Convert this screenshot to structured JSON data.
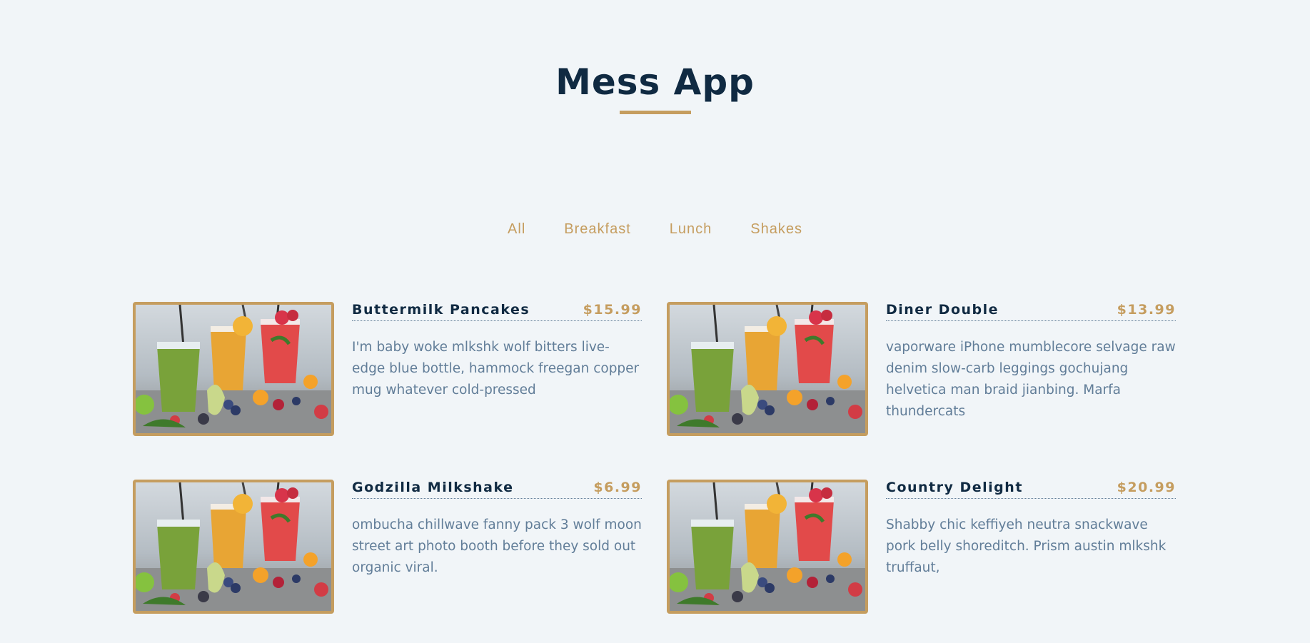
{
  "header": {
    "title": "Mess App"
  },
  "filters": [
    "All",
    "Breakfast",
    "Lunch",
    "Shakes"
  ],
  "colors": {
    "accent": "#c59d5f",
    "heading": "#102a42",
    "text": "#617d98",
    "background": "#f1f5f8"
  },
  "menu": [
    {
      "name": "Buttermilk Pancakes",
      "price": "$15.99",
      "desc": "I'm baby woke mlkshk wolf bitters live-edge blue bottle, hammock freegan copper mug whatever cold-pressed",
      "image": "fruit-smoothies-photo"
    },
    {
      "name": "Diner Double",
      "price": "$13.99",
      "desc": "vaporware iPhone mumblecore selvage raw denim slow-carb leggings gochujang helvetica man braid jianbing. Marfa thundercats",
      "image": "fruit-smoothies-photo"
    },
    {
      "name": "Godzilla Milkshake",
      "price": "$6.99",
      "desc": "ombucha chillwave fanny pack 3 wolf moon street art photo booth before they sold out organic viral.",
      "image": "fruit-smoothies-photo"
    },
    {
      "name": "Country Delight",
      "price": "$20.99",
      "desc": "Shabby chic keffiyeh neutra snackwave pork belly shoreditch. Prism austin mlkshk truffaut,",
      "image": "fruit-smoothies-photo"
    }
  ]
}
